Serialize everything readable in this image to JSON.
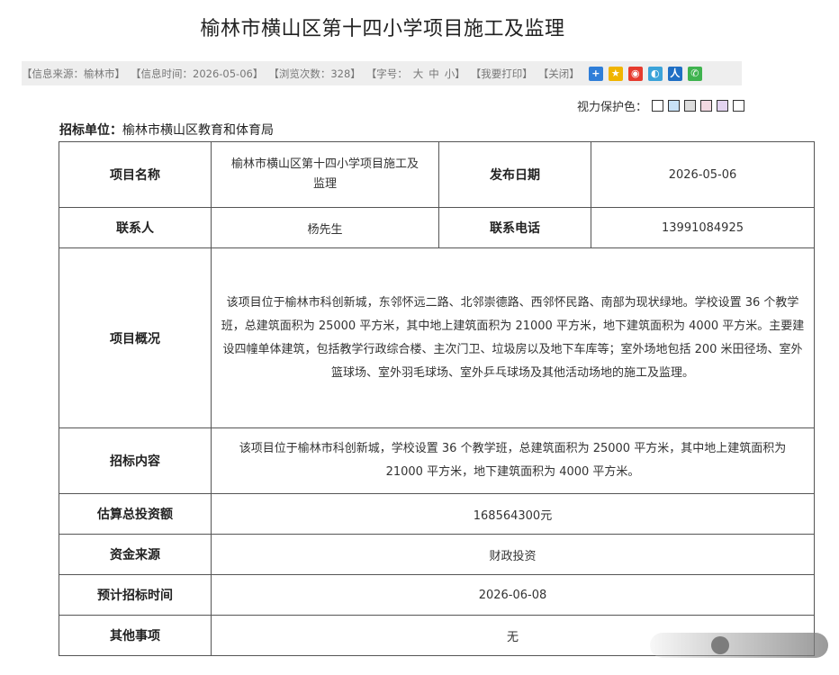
{
  "page": {
    "title": "榆林市横山区第十四小学项目施工及监理"
  },
  "info_bar": {
    "source": "【信息来源：榆林市】",
    "time": "【信息时间：2026-05-06】",
    "views": "【浏览次数：328】",
    "font_size_label": "【字号：",
    "font_big": "大",
    "font_mid": "中",
    "font_small": "小",
    "font_size_end": "】",
    "print": "【我要打印】",
    "close": "【关闭】",
    "share_icons": [
      "plus-share-icon",
      "qzone-icon",
      "weibo-icon",
      "tencent-weibo-icon",
      "renren-icon",
      "wechat-icon"
    ]
  },
  "eye_protect": {
    "label": "视力保护色：",
    "swatches": [
      "#ffffff",
      "#c8e2f7",
      "#dddddd",
      "#f3d9e2",
      "#e3d3f0",
      "#ffffff"
    ]
  },
  "tender_unit": {
    "label": "招标单位：",
    "value": "榆林市横山区教育和体育局"
  },
  "table": {
    "project_name_label": "项目名称",
    "project_name_line1": "榆林市横山区第十四小学项目施工及",
    "project_name_line2": "监理",
    "publish_date_label": "发布日期",
    "publish_date": "2026-05-06",
    "contact_label": "联系人",
    "contact": "杨先生",
    "phone_label": "联系电话",
    "phone": "13991084925",
    "overview_label": "项目概况",
    "overview": "该项目位于榆林市科创新城，东邻怀远二路、北邻崇德路、西邻怀民路、南部为现状绿地。学校设置 36 个教学班，总建筑面积为 25000 平方米，其中地上建筑面积为 21000 平方米，地下建筑面积为 4000 平方米。主要建设四幢单体建筑，包括教学行政综合楼、主次门卫、垃圾房以及地下车库等；室外场地包括 200 米田径场、室外篮球场、室外羽毛球场、室外乒乓球场及其他活动场地的施工及监理。",
    "content_label": "招标内容",
    "content": "该项目位于榆林市科创新城，学校设置 36 个教学班，总建筑面积为 25000 平方米，其中地上建筑面积为 21000 平方米，地下建筑面积为 4000 平方米。",
    "investment_label": "估算总投资额",
    "investment": "168564300元",
    "fund_label": "资金来源",
    "fund": "财政投资",
    "bid_time_label": "预计招标时间",
    "bid_time": "2026-06-08",
    "other_label": "其他事项",
    "other": "无"
  }
}
